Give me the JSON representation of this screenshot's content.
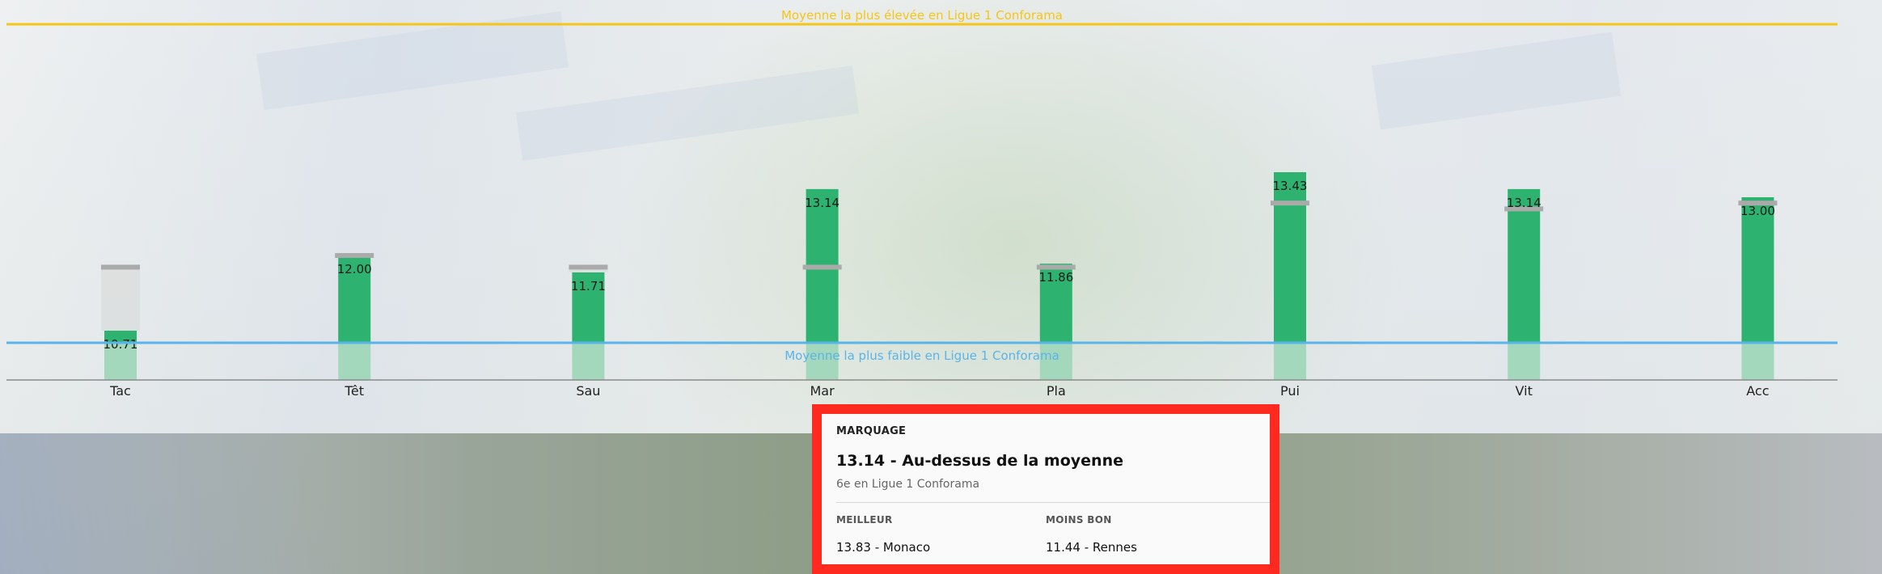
{
  "chart_data": {
    "type": "bar",
    "categories": [
      "Tac",
      "Têt",
      "Sau",
      "Mar",
      "Pla",
      "Pui",
      "Vit",
      "Acc"
    ],
    "series": [
      {
        "values": [
          10.71,
          12.0,
          11.71,
          13.14,
          11.86,
          13.43,
          13.14,
          13.0
        ]
      }
    ],
    "value_labels": [
      "10.71",
      "12.00",
      "11.71",
      "13.14",
      "11.86",
      "13.43",
      "13.14",
      "13.00"
    ],
    "reference_lines": [
      {
        "label": "Moyenne la plus élevée en Ligue 1 Conforama",
        "color": "#f5c518"
      },
      {
        "label": "Moyenne la plus faible en Ligue 1 Conforama",
        "color": "#5ab4ea"
      }
    ],
    "colors": {
      "bar": "#2db36f",
      "bar_below_min": "#a3d8bd",
      "average_marker": "#a9aaa9"
    }
  },
  "tooltip": {
    "attribute": "MARQUAGE",
    "value_text": "13.14 - Au-dessus de la moyenne",
    "rank_text": "6e en Ligue 1 Conforama",
    "best_label": "MEILLEUR",
    "best_value": "13.83 - Monaco",
    "worst_label": "MOINS BON",
    "worst_value": "11.44 - Rennes"
  }
}
